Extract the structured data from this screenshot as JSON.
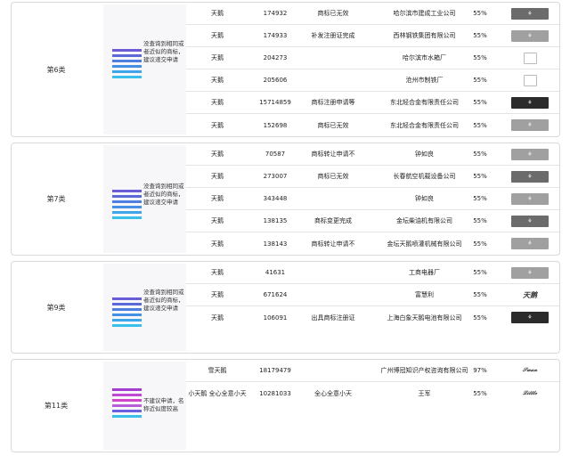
{
  "sections": [
    {
      "class_label": "第6类",
      "risk_text": "没查询到相同或者近似的商标，建议递交申请",
      "bar_colors": [
        "#6a5bd6",
        "#5b6ad8",
        "#4f7de0",
        "#4590e5",
        "#3ea6e8",
        "#39c0ea"
      ],
      "rows": [
        {
          "name": "天鹅",
          "number": "174932",
          "status": "商标已无效",
          "owner": "哈尔滨市建成工业公司",
          "similarity": "55%",
          "logo_icon": "swan-logo-icon"
        },
        {
          "name": "天鹅",
          "number": "174933",
          "status": "补发注册证完成",
          "owner": "西林钢铁集团有限公司",
          "similarity": "55%",
          "logo_icon": "swan-logo-icon"
        },
        {
          "name": "天鹅",
          "number": "204273",
          "status": "",
          "owner": "哈尔滨市水箱厂",
          "similarity": "55%",
          "logo_icon": "placeholder-logo-icon"
        },
        {
          "name": "天鹅",
          "number": "205606",
          "status": "",
          "owner": "沧州市制铁厂",
          "similarity": "55%",
          "logo_icon": "placeholder-logo-icon"
        },
        {
          "name": "天鹅",
          "number": "15714859",
          "status": "商标注册申请等",
          "owner": "东北轻合金有限责任公司",
          "similarity": "55%",
          "logo_icon": "swan-logo-icon"
        },
        {
          "name": "天鹅",
          "number": "152698",
          "status": "商标已无效",
          "owner": "东北轻合金有限责任公司",
          "similarity": "55%",
          "logo_icon": "swan-logo-icon"
        }
      ]
    },
    {
      "class_label": "第7类",
      "risk_text": "没查询到相同或者近似的商标，建议递交申请",
      "bar_colors": [
        "#6a5bd6",
        "#5b6ad8",
        "#4f7de0",
        "#4590e5",
        "#3ea6e8",
        "#39c0ea"
      ],
      "rows": [
        {
          "name": "天鹅",
          "number": "70587",
          "status": "商标转让申请不",
          "owner": "钟如良",
          "similarity": "55%",
          "logo_icon": "swan-logo-icon"
        },
        {
          "name": "天鹅",
          "number": "273007",
          "status": "商标已无效",
          "owner": "长春航空机载设备公司",
          "similarity": "55%",
          "logo_icon": "swan-logo-icon"
        },
        {
          "name": "天鹅",
          "number": "343448",
          "status": "",
          "owner": "钟如良",
          "similarity": "55%",
          "logo_icon": "swan-logo-icon"
        },
        {
          "name": "天鹅",
          "number": "138135",
          "status": "商标变更完成",
          "owner": "金坛柴油机有限公司",
          "similarity": "55%",
          "logo_icon": "swan-logo-icon"
        },
        {
          "name": "天鹅",
          "number": "138143",
          "status": "商标转让申请不",
          "owner": "金坛天鹅喷灌机械有限公司",
          "similarity": "55%",
          "logo_icon": "swan-logo-icon"
        }
      ]
    },
    {
      "class_label": "第9类",
      "risk_text": "没查询到相同或者近似的商标，建议递交申请",
      "bar_colors": [
        "#6a5bd6",
        "#5b6ad8",
        "#4f7de0",
        "#4590e5",
        "#3ea6e8",
        "#39c0ea"
      ],
      "rows": [
        {
          "name": "天鹅",
          "number": "41631",
          "status": "",
          "owner": "工商电器厂",
          "similarity": "55%",
          "logo_icon": "swan-logo-icon"
        },
        {
          "name": "天鹅",
          "number": "671624",
          "status": "",
          "owner": "富慧利",
          "similarity": "55%",
          "logo_icon": "swan-text-logo-icon"
        },
        {
          "name": "天鹅",
          "number": "106091",
          "status": "出具商标注册证",
          "owner": "上海白象天鹅电池有限公司",
          "similarity": "55%",
          "logo_icon": "swan-logo-icon"
        }
      ]
    },
    {
      "class_label": "第11类",
      "risk_text": "不建议申请，名称近似度较高",
      "bar_colors": [
        "#a43ed0",
        "#c04ad4",
        "#d048c8",
        "#b85ed9",
        "#6b5ee0",
        "#39c0ea"
      ],
      "rows": [
        {
          "name": "雪天鹅",
          "number": "18179479",
          "status": "",
          "owner": "广州博冠知识产权咨询有限公司",
          "similarity": "97%",
          "logo_icon": "script-logo-icon"
        },
        {
          "name": "小天鹅 全心全意小天",
          "number": "10281033",
          "status": "全心全意小天",
          "owner": "王军",
          "similarity": "55%",
          "logo_icon": "script-logo-icon"
        }
      ]
    }
  ]
}
